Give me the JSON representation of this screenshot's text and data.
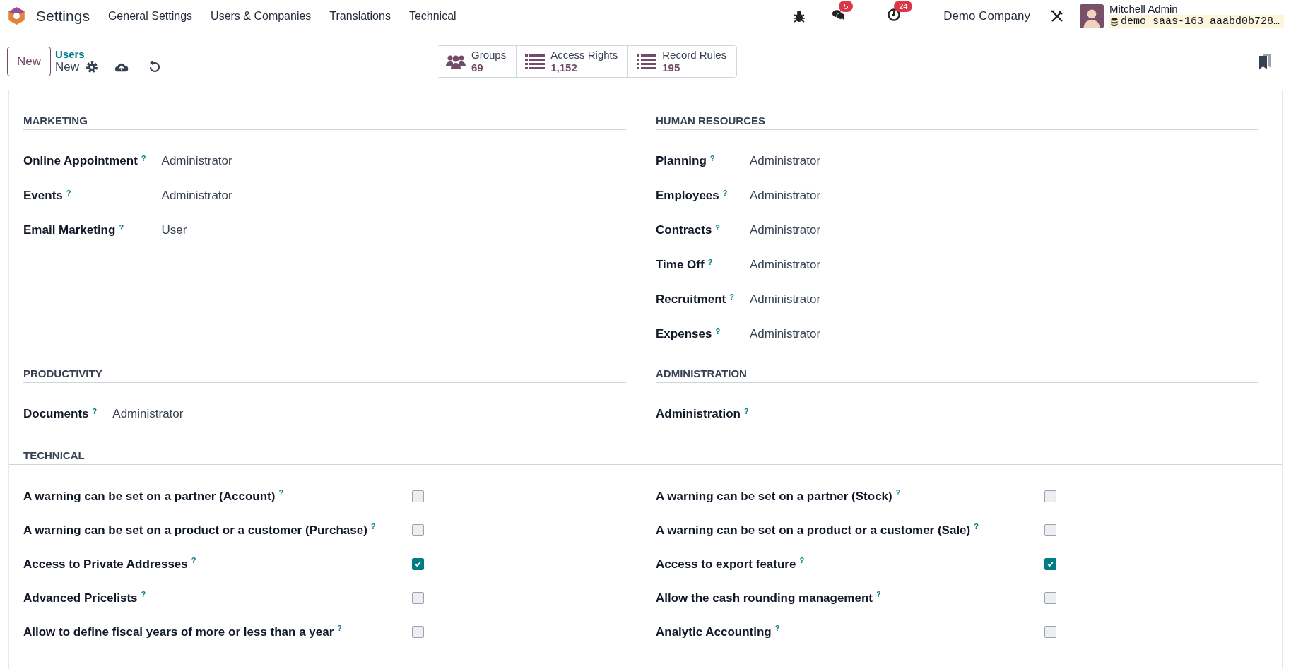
{
  "navbar": {
    "app_name": "Settings",
    "menu": [
      "General Settings",
      "Users & Companies",
      "Translations",
      "Technical"
    ],
    "messages_badge": "5",
    "activities_badge": "24",
    "company": "Demo Company",
    "user_name": "Mitchell Admin",
    "database": "demo_saas-163_aaabd0b728…"
  },
  "control_panel": {
    "new_button": "New",
    "breadcrumb_parent": "Users",
    "breadcrumb_current": "New",
    "smart_buttons": [
      {
        "kind": "groups",
        "label": "Groups",
        "value": "69"
      },
      {
        "kind": "list",
        "label": "Access Rights",
        "value": "1,152"
      },
      {
        "kind": "list",
        "label": "Record Rules",
        "value": "195"
      }
    ]
  },
  "sections": [
    {
      "title": "MARKETING",
      "fields": [
        {
          "label": "Online Appointment",
          "help": "?",
          "value": "Administrator"
        },
        {
          "label": "Events",
          "help": "?",
          "value": "Administrator"
        },
        {
          "label": "Email Marketing",
          "help": "?",
          "value": "User"
        }
      ]
    },
    {
      "title": "HUMAN RESOURCES",
      "fields": [
        {
          "label": "Planning",
          "help": "?",
          "value": "Administrator"
        },
        {
          "label": "Employees",
          "help": "?",
          "value": "Administrator"
        },
        {
          "label": "Contracts",
          "help": "?",
          "value": "Administrator"
        },
        {
          "label": "Time Off",
          "help": "?",
          "value": "Administrator"
        },
        {
          "label": "Recruitment",
          "help": "?",
          "value": "Administrator"
        },
        {
          "label": "Expenses",
          "help": "?",
          "value": "Administrator"
        }
      ]
    },
    {
      "title": "PRODUCTIVITY",
      "fields": [
        {
          "label": "Documents",
          "help": "?",
          "value": "Administrator"
        }
      ]
    },
    {
      "title": "ADMINISTRATION",
      "fields": [
        {
          "label": "Administration",
          "help": "?"
        }
      ]
    }
  ],
  "technical": {
    "title": "TECHNICAL",
    "left": [
      {
        "label": "A warning can be set on a partner (Account)",
        "help": "?",
        "checked": false
      },
      {
        "label": "A warning can be set on a product or a customer (Purchase)",
        "help": "?",
        "checked": false
      },
      {
        "label": "Access to Private Addresses",
        "help": "?",
        "checked": true
      },
      {
        "label": "Advanced Pricelists",
        "help": "?",
        "checked": false
      },
      {
        "label": "Allow to define fiscal years of more or less than a year",
        "help": "?",
        "checked": false
      }
    ],
    "right": [
      {
        "label": "A warning can be set on a partner (Stock)",
        "help": "?",
        "checked": false
      },
      {
        "label": "A warning can be set on a product or a customer (Sale)",
        "help": "?",
        "checked": false
      },
      {
        "label": "Access to export feature",
        "help": "?",
        "checked": true
      },
      {
        "label": "Allow the cash rounding management",
        "help": "?",
        "checked": false
      },
      {
        "label": "Analytic Accounting",
        "help": "?",
        "checked": false
      }
    ]
  }
}
